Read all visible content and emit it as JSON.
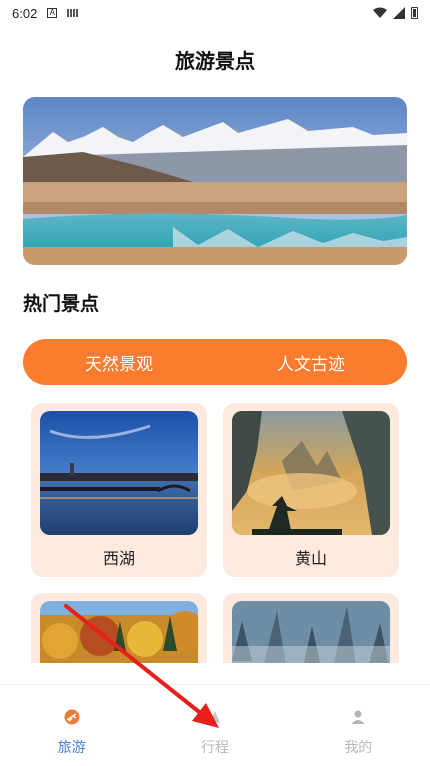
{
  "status_bar": {
    "time": "6:02",
    "icon_a": "A"
  },
  "page_title": "旅游景点",
  "section_title": "热门景点",
  "segments": [
    {
      "label": "天然景观"
    },
    {
      "label": "人文古迹"
    }
  ],
  "cards": [
    {
      "name": "西湖",
      "image": "west-lake-image"
    },
    {
      "name": "黄山",
      "image": "huangshan-image"
    }
  ],
  "partial_cards": [
    {
      "image": "autumn-forest-image"
    },
    {
      "image": "misty-peaks-image"
    }
  ],
  "tabs": [
    {
      "label": "旅游",
      "icon": "travel-icon",
      "active": true
    },
    {
      "label": "行程",
      "icon": "itinerary-icon",
      "active": false
    },
    {
      "label": "我的",
      "icon": "profile-icon",
      "active": false
    }
  ],
  "colors": {
    "accent": "#fb7b2f",
    "card_bg": "#fde9de",
    "tab_active": "#4a7ee0",
    "tab_inactive": "#b9b9b9",
    "annotation_arrow": "#e8201c"
  }
}
